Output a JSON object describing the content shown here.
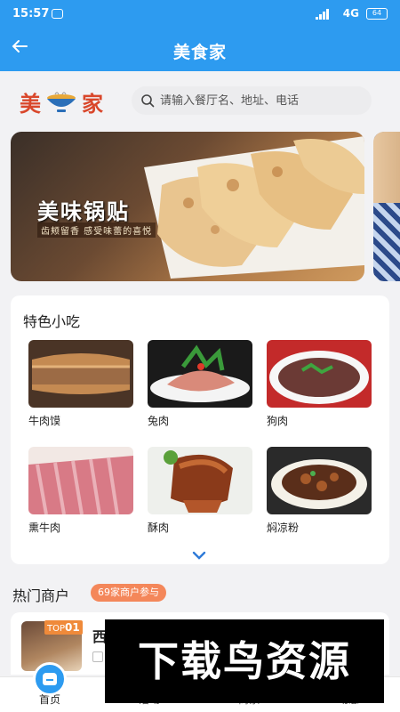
{
  "status_bar": {
    "time": "15:57",
    "network": "4G",
    "battery": "64"
  },
  "nav": {
    "title": "美食家"
  },
  "logo": {
    "left_char": "美",
    "right_char": "家"
  },
  "search": {
    "placeholder": "请输入餐厅名、地址、电话"
  },
  "banner": {
    "title": "美味锅贴",
    "subtitle": "齿颊留香 感受味蕾的喜悦"
  },
  "featured": {
    "title": "特色小吃",
    "items": [
      {
        "label": "牛肉馍"
      },
      {
        "label": "兔肉"
      },
      {
        "label": "狗肉"
      },
      {
        "label": "熏牛肉"
      },
      {
        "label": "酥肉"
      },
      {
        "label": "焖凉粉"
      }
    ]
  },
  "hot": {
    "title": "热门商户",
    "badge": "69家商户参与"
  },
  "shop": {
    "rank_prefix": "TOP",
    "rank_num": "01",
    "name_partial": "西"
  },
  "tabbar": {
    "tabs": [
      {
        "label": "首页"
      },
      {
        "label": "活动"
      },
      {
        "label": "商家"
      },
      {
        "label": "动态"
      }
    ]
  },
  "watermark": {
    "text": "下载鸟资源"
  },
  "colors": {
    "primary": "#2d9bf0",
    "accent": "#f4875a",
    "logo": "#d9472b"
  }
}
